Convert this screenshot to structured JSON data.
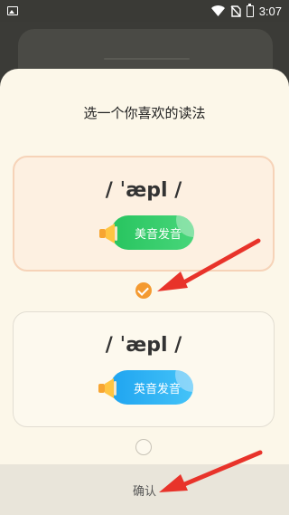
{
  "status_bar": {
    "time": "3:07",
    "icons": [
      "gallery-icon",
      "wifi-icon",
      "no-sim-icon",
      "battery-icon"
    ]
  },
  "sheet": {
    "title": "选一个你喜欢的读法",
    "options": [
      {
        "phonetic": "/ ˈæpl /",
        "button_label": "美音发音",
        "selected": true
      },
      {
        "phonetic": "/ ˈæpl /",
        "button_label": "英音发音",
        "selected": false
      }
    ],
    "confirm_label": "确认"
  },
  "colors": {
    "sheet_bg": "#fcf7e9",
    "us_button": "#27c45f",
    "uk_button": "#1fa4f0",
    "radio_checked": "#f49a30",
    "arrow": "#e8332a"
  }
}
